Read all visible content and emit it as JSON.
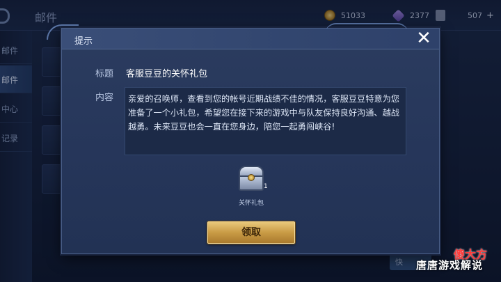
{
  "background": {
    "screen_title": "邮件",
    "resources": {
      "gold": "51033",
      "gems": "2377",
      "tickets": "507",
      "tickets_plus": "+"
    },
    "sidebar_tabs": [
      "邮件",
      "邮件",
      "中心",
      "记录"
    ],
    "bottom_button": "快",
    "watermark": "唐唐游戏解说",
    "watermark_logo": "傻大方"
  },
  "dialog": {
    "title": "提示",
    "close_icon": "✕",
    "title_label": "标题",
    "title_value": "客服豆豆的关怀礼包",
    "content_label": "内容",
    "content_value": "亲爱的召唤师，查看到您的帐号近期战绩不佳的情况，客服豆豆特意为您准备了一个小礼包，希望您在接下来的游戏中与队友保持良好沟通、越战越勇。未来豆豆也会一直在您身边，陪您一起勇闯峡谷!",
    "gift": {
      "icon": "treasure-chest-icon",
      "count": "1",
      "name": "关怀礼包"
    },
    "claim_button": "领取"
  }
}
